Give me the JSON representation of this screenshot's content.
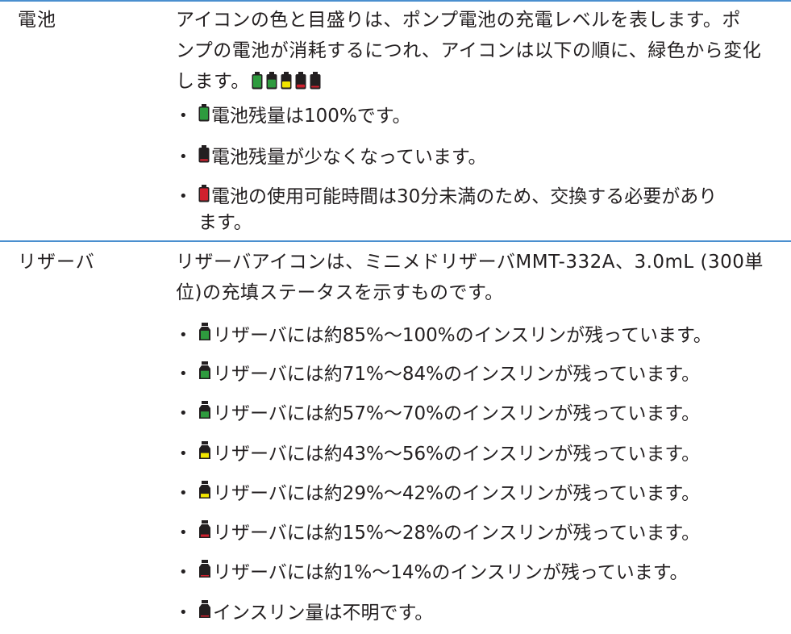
{
  "battery": {
    "label": "電池",
    "desc_line1": "アイコンの色と目盛りは、ポンプ電池の充電レベルを表します。ポ",
    "desc_line2": "ンプの電池が消耗するにつれ、アイコンは以下の順に、緑色から変化",
    "desc_line3": "します。",
    "sequence_icons": [
      {
        "name": "battery-full-green-icon",
        "fill": 1.0,
        "color": "#2e9b3e"
      },
      {
        "name": "battery-mid-green-icon",
        "fill": 0.66,
        "color": "#2e9b3e"
      },
      {
        "name": "battery-yellow-icon",
        "fill": 0.5,
        "color": "#f2e600"
      },
      {
        "name": "battery-low-red-icon",
        "fill": 0.25,
        "color": "#d0202e"
      },
      {
        "name": "battery-empty-red-icon",
        "fill": 0.1,
        "color": "#d0202e"
      }
    ],
    "items": [
      {
        "text": "電池残量は100%です。",
        "icon_color": "#2e9b3e",
        "icon_fill": 1.0
      },
      {
        "text": "電池残量が少なくなっています。",
        "icon_color": "#d0202e",
        "icon_fill": 0.15
      },
      {
        "text": "電池の使用可能時間は30分未満のため、交換する必要があり",
        "text2": "ます。",
        "icon_color": "#d0202e",
        "icon_fill": 1.0
      }
    ]
  },
  "reservoir": {
    "label": "リザーバ",
    "desc_line1": "リザーバアイコンは、ミニメドリザーバMMT-332A、3.0mL (300単",
    "desc_line2": "位)の充填ステータスを示すものです。",
    "items": [
      {
        "text": "リザーバには約85%～100%のインスリンが残っています。",
        "color": "#2e9b3e",
        "fill": 1.0
      },
      {
        "text": "リザーバには約71%～84%のインスリンが残っています。",
        "color": "#2e9b3e",
        "fill": 0.84
      },
      {
        "text": "リザーバには約57%～70%のインスリンが残っています。",
        "color": "#2e9b3e",
        "fill": 0.7
      },
      {
        "text": "リザーバには約43%～56%のインスリンが残っています。",
        "color": "#f2e600",
        "fill": 0.56
      },
      {
        "text": "リザーバには約29%～42%のインスリンが残っています。",
        "color": "#f2e600",
        "fill": 0.42
      },
      {
        "text": "リザーバには約15%～28%のインスリンが残っています。",
        "color": "#d0202e",
        "fill": 0.28
      },
      {
        "text": "リザーバには約1%～14%のインスリンが残っています。",
        "color": "#d0202e",
        "fill": 0.14
      },
      {
        "text": "インスリン量は不明です。",
        "color": "#d0202e",
        "fill": 0.0
      }
    ]
  }
}
